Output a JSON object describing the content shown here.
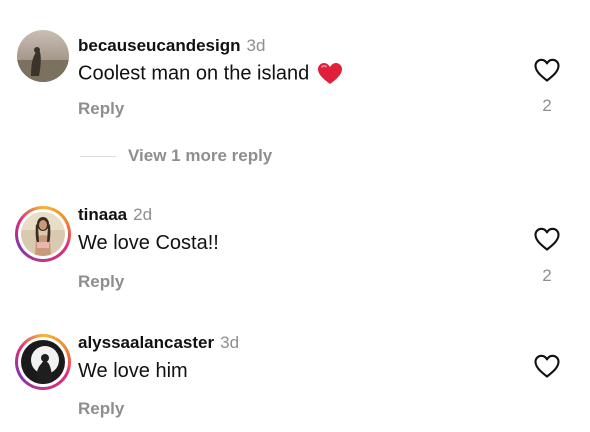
{
  "comments": [
    {
      "username": "becauseucandesign",
      "time": "3d",
      "text": "Coolest man on the island",
      "emoji": "red-heart",
      "reply_label": "Reply",
      "like_count": "2",
      "more_replies_label": "View 1 more reply",
      "has_story_ring": false
    },
    {
      "username": "tinaaa",
      "time": "2d",
      "text": "We love Costa!!",
      "reply_label": "Reply",
      "like_count": "2",
      "has_story_ring": true
    },
    {
      "username": "alyssaalancaster",
      "time": "3d",
      "text": "We love him",
      "reply_label": "Reply",
      "like_count": "",
      "has_story_ring": true
    }
  ],
  "icons": {
    "like": "heart-outline-icon",
    "emoji": "red-heart-emoji-icon"
  },
  "colors": {
    "secondary_text": "#8e8e8e",
    "primary_text": "#111111",
    "heart_emoji": "#e0203a",
    "story_ring_start": "#f7b733",
    "story_ring_end": "#c13584"
  }
}
